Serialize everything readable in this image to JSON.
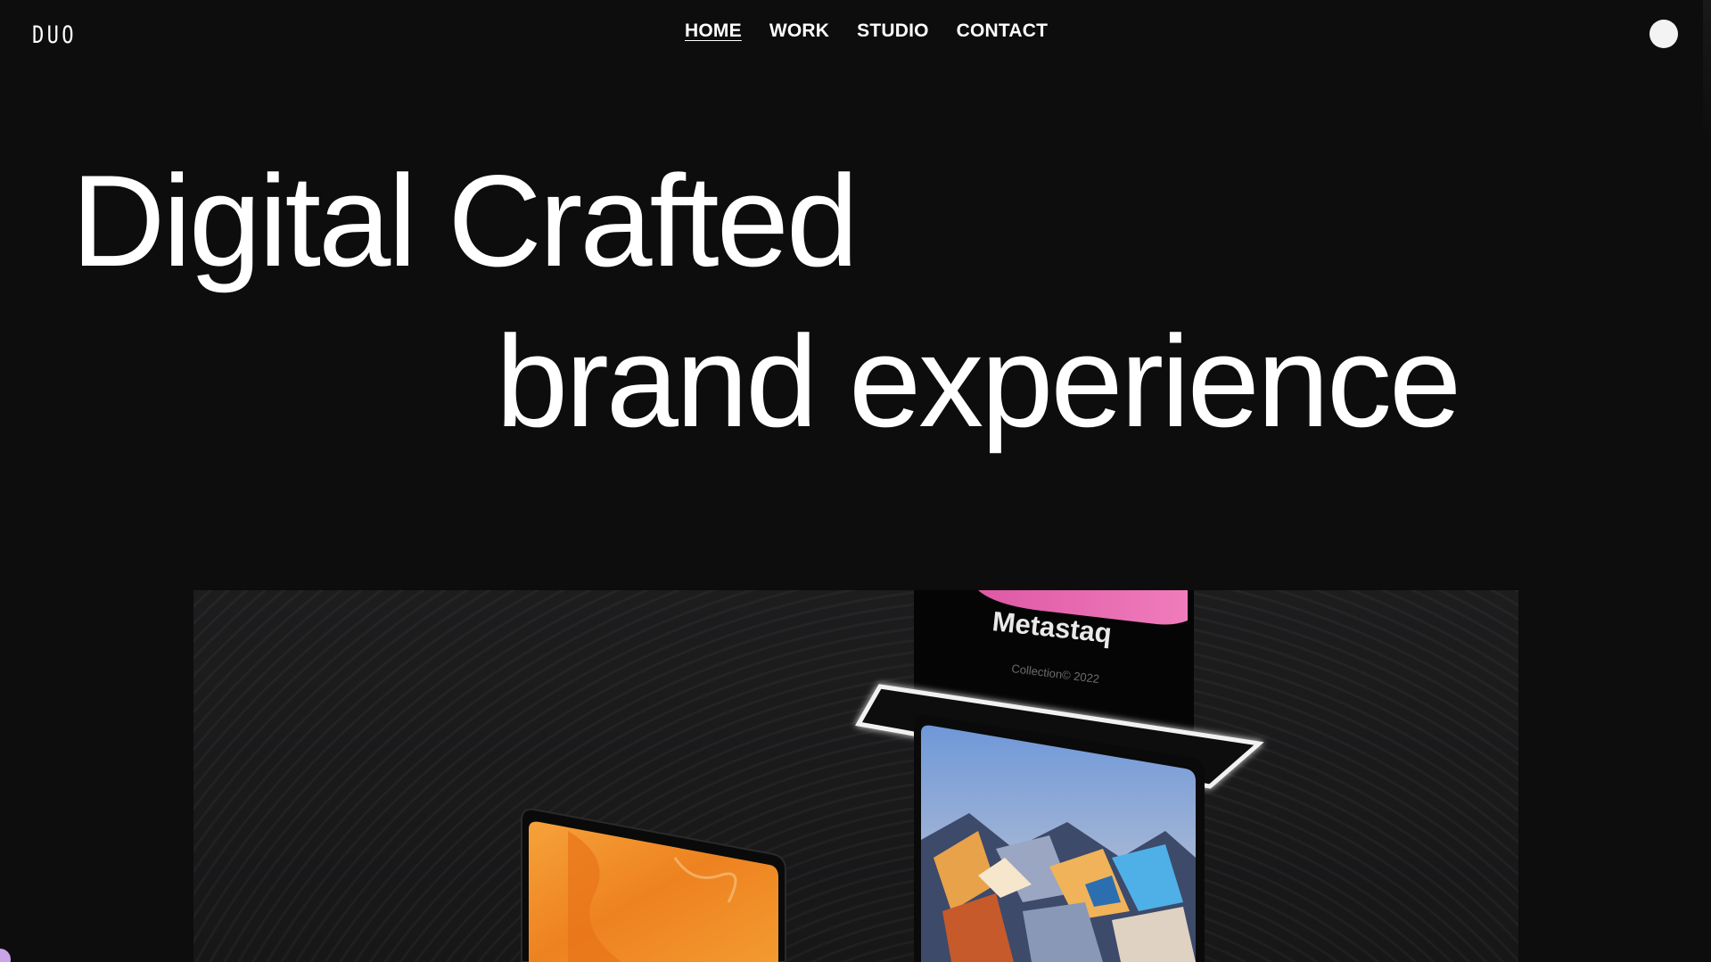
{
  "header": {
    "logo": "DUO",
    "nav": [
      {
        "label": "HOME",
        "active": true
      },
      {
        "label": "WORK",
        "active": false
      },
      {
        "label": "STUDIO",
        "active": false
      },
      {
        "label": "CONTACT",
        "active": false
      }
    ]
  },
  "hero": {
    "line1": "Digital Crafted",
    "line2": "brand experience"
  },
  "showcase": {
    "card_title": "Metastaq",
    "card_subtitle": "Collection© 2022"
  },
  "colors": {
    "background": "#0e0d0e",
    "text": "#ffffff",
    "menu_dot": "#f3f3f3",
    "accent_pink": "#e85aa8",
    "accent_orange": "#f08a1c",
    "corner_blob": "#c9a5e8"
  },
  "icons": {
    "menu": "circle-menu-icon"
  }
}
